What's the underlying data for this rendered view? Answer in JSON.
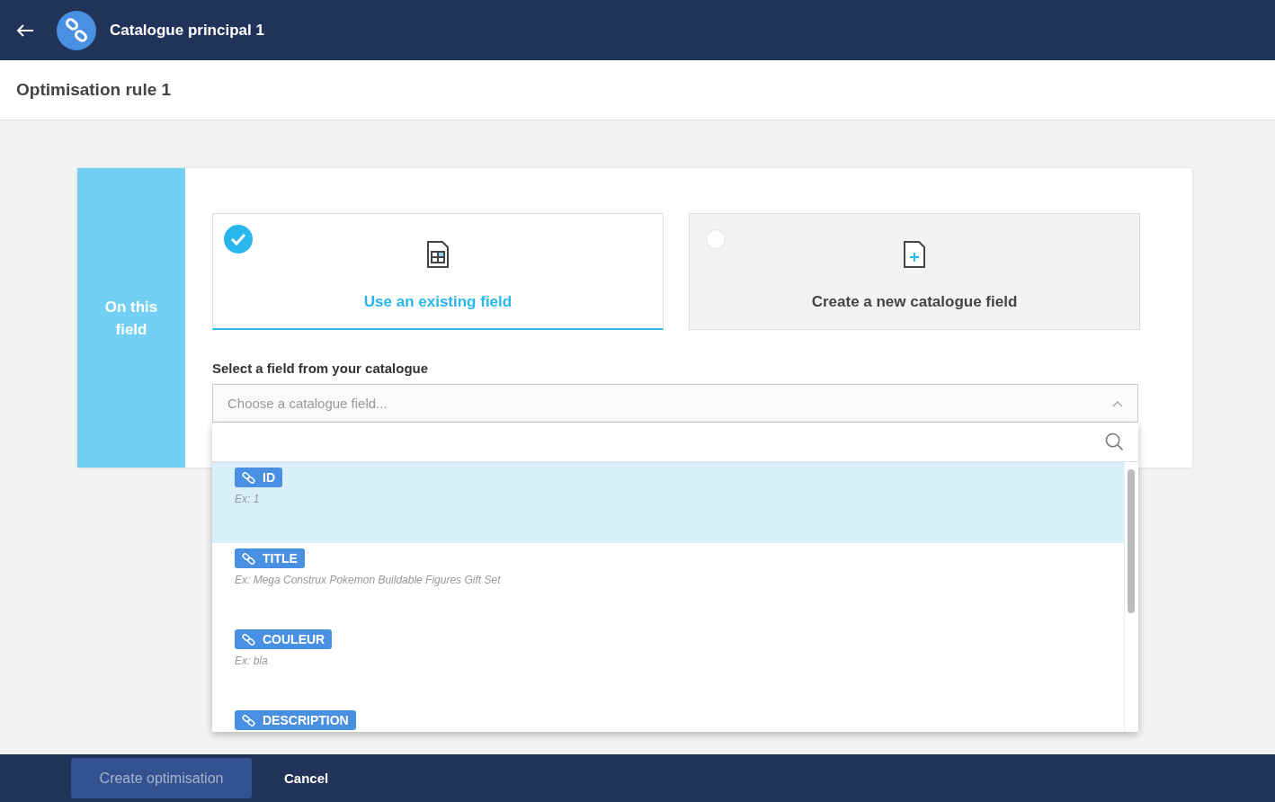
{
  "header": {
    "title": "Catalogue principal 1"
  },
  "subheader": {
    "title": "Optimisation rule 1"
  },
  "section": {
    "label": "On this field"
  },
  "options": [
    {
      "label": "Use an existing field",
      "kind": "existing",
      "selected": true
    },
    {
      "label": "Create a new catalogue field",
      "kind": "new",
      "selected": false
    }
  ],
  "field_select": {
    "label": "Select a field from your catalogue",
    "placeholder": "Choose a catalogue field...",
    "expanded": true
  },
  "dropdown_items": [
    {
      "name": "ID",
      "example": "Ex: 1",
      "selected": true
    },
    {
      "name": "TITLE",
      "example": "Ex: Mega Construx Pokemon Buildable Figures Gift Set",
      "selected": false
    },
    {
      "name": "COULEUR",
      "example": "Ex: bla",
      "selected": false
    },
    {
      "name": "DESCRIPTION",
      "selected": false
    }
  ],
  "footer": {
    "primary": {
      "label": "Create optimisation",
      "disabled": true
    },
    "secondary": {
      "label": "Cancel"
    }
  }
}
